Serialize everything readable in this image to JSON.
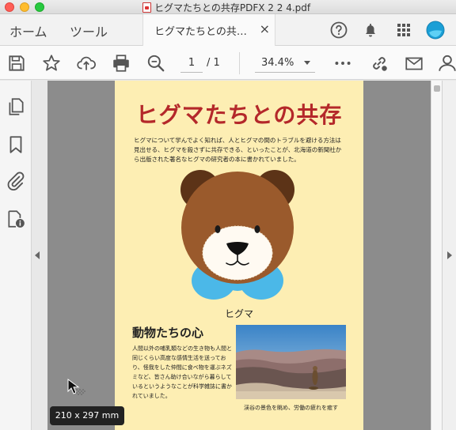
{
  "window": {
    "title": "ヒグマたちとの共存PDFX 2 2 4.pdf"
  },
  "tabs": {
    "home": "ホーム",
    "tools": "ツール",
    "document": "ヒグマたちとの共…",
    "close_symbol": "×"
  },
  "toolbar": {
    "page_current": "1",
    "page_total": "/ 1",
    "zoom": "34.4%"
  },
  "page": {
    "title": "ヒグマたちとの共存",
    "intro": "ヒグマについて学んでよく知れば、人とヒグマの間のトラブルを避ける方法は見出せる、ヒグマを殺さずに共存できる、といったことが、北海道の新聞社から出版された著名なヒグマの研究者の本に書かれていました。",
    "bear_caption": "ヒグマ",
    "section_title": "動物たちの心",
    "section_body": "人間以外の哺乳類などの生き物も人間と同じくらい高度な感情生活を送っており、怪我をした仲間に食べ物を運ぶネズミなど、皆さん助け合いながら暮らしているというようなことが科学雑誌に書かれていました。",
    "photo_caption": "渓谷の景色を眺め、労働の疲れを癒す"
  },
  "tooltip": {
    "page_size": "210 x 297 mm"
  },
  "colors": {
    "title_red": "#b4282a",
    "page_bg": "#fdeeb3",
    "bear_brown": "#9a5a2c",
    "bear_ear": "#5c3317",
    "bib_blue": "#4bb8e8"
  }
}
